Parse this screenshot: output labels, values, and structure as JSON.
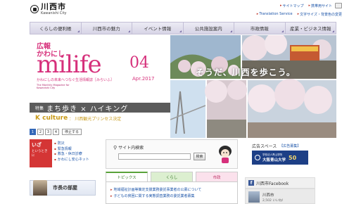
{
  "header": {
    "logo_jp": "川西市",
    "logo_en": "Kawanishi City",
    "links_row1": [
      "サイトマップ",
      "携帯用サイト"
    ],
    "links_row2": [
      "Translation Service",
      "文字サイズ・背景色の変更"
    ]
  },
  "nav": {
    "items": [
      "くらしの便利帳",
      "川西市の魅力",
      "イベント情報",
      "公共施設案内",
      "市政情報",
      "産業・ビジネス情報"
    ]
  },
  "hero": {
    "kouhou": "広報",
    "kawanishi": "かわにし",
    "title": "milife",
    "issue": "04",
    "date": "Apr.2017",
    "tagline": "かわにしの未来へつなぐ生活情報誌［みらいふ］",
    "sub": "The Monthly Magazine for Kawanishi City",
    "slogan": "そうだ、川西を歩こう。",
    "feature_tag": "特集",
    "feature_text": "まち歩き × ハイキング",
    "k_title": "K culture",
    "k_sep": "：",
    "k_text": "川西観光プリンセス決定",
    "pages": [
      "1",
      "2",
      "3",
      "4"
    ],
    "stop_label": "停止する"
  },
  "iza": {
    "line1": "いざ",
    "line2": "というときに",
    "links": [
      "防災",
      "緊急情報",
      "救急・休日診療",
      "かわにし安心ネット"
    ]
  },
  "mayor": {
    "label": "市長の部屋"
  },
  "search": {
    "title": "サイト内検索",
    "placeholder": "",
    "button": "検索"
  },
  "tabs": [
    "トピックス",
    "くらし",
    "市政"
  ],
  "news": [
    "地域福祉計画等策定支援業務委託事業者の公募について",
    "子どもの貧困に関する実態調査業務の委託業者募集"
  ],
  "ad": {
    "title": "広告スペース",
    "link": "【広告募集】",
    "sub": "学校法人青山学院",
    "name": "大阪青山大学",
    "badge": "50"
  },
  "facebook": {
    "head": "川西市Facebook",
    "name": "川西市",
    "likes": "2,502 いいね!"
  },
  "colors": {
    "brand_pink": "#d6307b",
    "nav_bg": "#dcd9e9",
    "link_blue": "#1a53a8",
    "iza_red": "#d43535"
  }
}
